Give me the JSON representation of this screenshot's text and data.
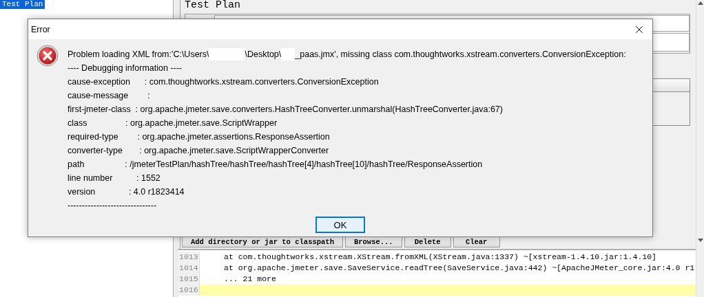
{
  "tree": {
    "items": [
      {
        "label": "Test Plan",
        "selected": true
      }
    ]
  },
  "panel": {
    "title": "Test Plan"
  },
  "classpath_buttons": [
    "Add directory or jar to classpath",
    "Browse...",
    "Delete",
    "Clear"
  ],
  "log": {
    "lines": [
      {
        "number": "1013",
        "text": "at com.thoughtworks.xstream.XStream.fromXML(XStream.java:1337) ~[xstream-1.4.10.jar:1.4.10]",
        "current": false
      },
      {
        "number": "1014",
        "text": "at org.apache.jmeter.save.SaveService.readTree(SaveService.java:442) ~[ApacheJMeter_core.jar:4.0 r1",
        "current": false
      },
      {
        "number": "1015",
        "text": "... 21 more",
        "current": false
      },
      {
        "number": "1016",
        "current": true
      }
    ]
  },
  "dialog": {
    "title": "Error",
    "message_parts": [
      "Problem loading XML from:'C:\\Users\\",
      "\\Desktop\\",
      "_paas.jmx', missing class com.thoughtworks.xstream.converters.ConversionException:"
    ],
    "header": "---- Debugging information ----",
    "details": [
      "cause-exception      : com.thoughtworks.xstream.converters.ConversionException",
      "cause-message        :",
      "first-jmeter-class  : org.apache.jmeter.save.converters.HashTreeConverter.unmarshal(HashTreeConverter.java:67)",
      "class                : org.apache.jmeter.save.ScriptWrapper",
      "required-type        : org.apache.jmeter.assertions.ResponseAssertion",
      "converter-type       : org.apache.jmeter.save.ScriptWrapperConverter",
      "path                 : /jmeterTestPlan/hashTree/hashTree/hashTree[4]/hashTree[10]/hashTree/ResponseAssertion",
      "line number          : 1552",
      "version              : 4.0 r1823414"
    ],
    "footer": "-------------------------------",
    "buttons": [
      {
        "label": "OK",
        "default": true
      }
    ]
  }
}
